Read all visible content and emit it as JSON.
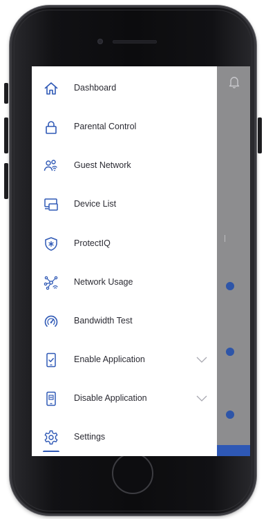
{
  "menu": {
    "items": [
      {
        "id": "dashboard",
        "label": "Dashboard",
        "icon": "home-icon"
      },
      {
        "id": "parental-control",
        "label": "Parental Control",
        "icon": "lock-icon"
      },
      {
        "id": "guest-network",
        "label": "Guest Network",
        "icon": "guest-users-icon"
      },
      {
        "id": "device-list",
        "label": "Device List",
        "icon": "devices-icon"
      },
      {
        "id": "protectiq",
        "label": "ProtectIQ",
        "icon": "shield-icon"
      },
      {
        "id": "network-usage",
        "label": "Network Usage",
        "icon": "network-usage-icon"
      },
      {
        "id": "bandwidth-test",
        "label": "Bandwidth Test",
        "icon": "speedometer-icon"
      },
      {
        "id": "enable-application",
        "label": "Enable Application",
        "icon": "enable-app-icon",
        "expandable": true
      },
      {
        "id": "disable-application",
        "label": "Disable Application",
        "icon": "disable-app-icon",
        "expandable": true
      },
      {
        "id": "settings",
        "label": "Settings",
        "icon": "gear-icon"
      }
    ]
  },
  "colors": {
    "icon_blue": "#2e58b5",
    "text": "#2b2b33",
    "overlay": "#8d8d8f"
  }
}
